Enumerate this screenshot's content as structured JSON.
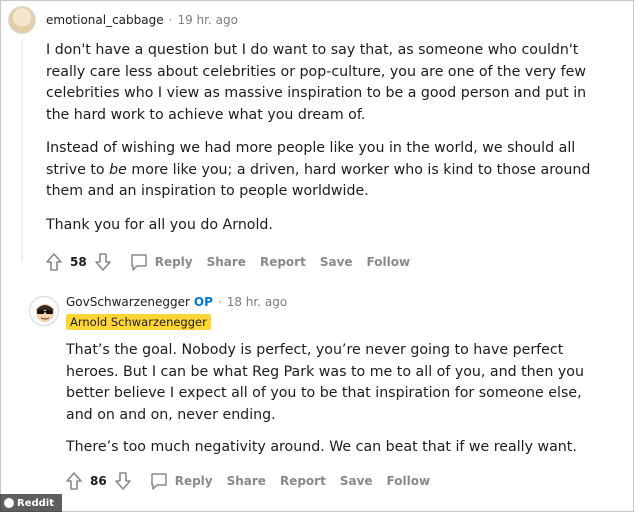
{
  "comment1": {
    "username": "emotional_cabbage",
    "separator": "·",
    "time": "19 hr. ago",
    "avatar_icon": "user-avatar-icon",
    "body_p1": "I don't have a question but I do want to say that, as someone who couldn't really care less about celebrities or pop-culture, you are one of the very few celebrities who I view as massive inspiration to be a good person and put in the hard work to achieve what you dream of.",
    "body_p2_pre": "Instead of wishing we had more people like you in the world, we should all strive to ",
    "body_p2_em": "be",
    "body_p2_post": " more like you; a driven, hard worker who is kind to those around them and an inspiration to people worldwide.",
    "body_p3": "Thank you for all you do Arnold.",
    "score": "58",
    "actions": {
      "reply": "Reply",
      "share": "Share",
      "report": "Report",
      "save": "Save",
      "follow": "Follow"
    }
  },
  "comment2": {
    "username": "GovSchwarzenegger",
    "op_badge": "OP",
    "separator": "·",
    "time": "18 hr. ago",
    "flair": "Arnold Schwarzenegger",
    "avatar_icon": "sunglasses-avatar-icon",
    "body_p1": "That’s the goal. Nobody is perfect, you’re never going to have perfect heroes. But I can be what Reg Park was to me to all of you, and then you better believe I expect all of you to be that inspiration for someone else, and on and on, never ending.",
    "body_p2": "There’s too much negativity around. We can beat that if we really want.",
    "score": "86",
    "actions": {
      "reply": "Reply",
      "share": "Share",
      "report": "Report",
      "save": "Save",
      "follow": "Follow"
    }
  },
  "watermark": "Reddit",
  "colors": {
    "op_blue": "#0079d3",
    "flair_yellow": "#ffd635",
    "meta_gray": "#878a8c"
  }
}
